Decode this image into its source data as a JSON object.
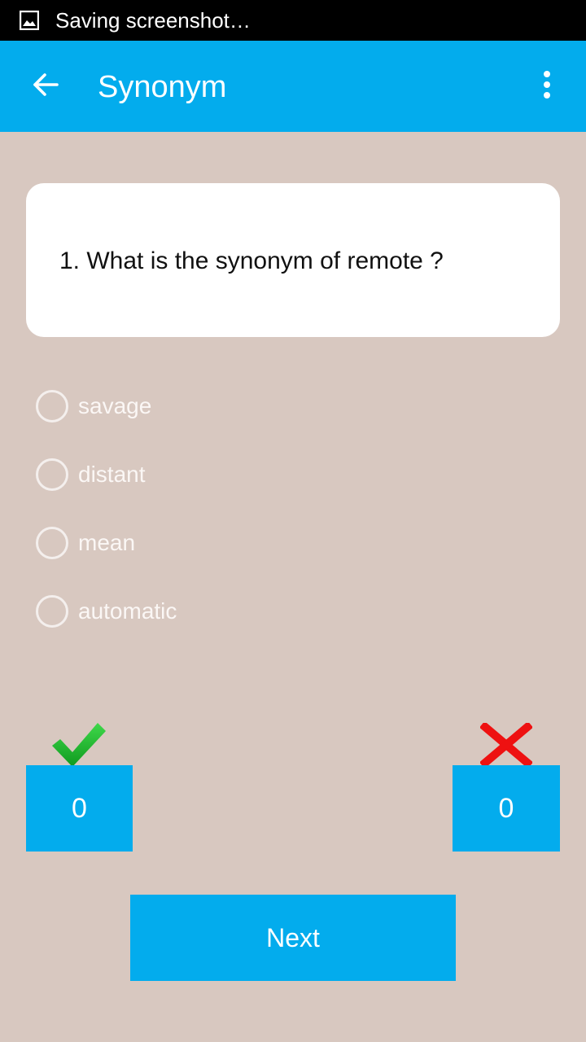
{
  "status_bar": {
    "notification_text": "Saving screenshot…"
  },
  "app_bar": {
    "title": "Synonym"
  },
  "question": {
    "text": "1. What is the synonym of remote ?"
  },
  "options": [
    {
      "label": "savage"
    },
    {
      "label": "distant"
    },
    {
      "label": "mean"
    },
    {
      "label": "automatic"
    }
  ],
  "scores": {
    "correct": "0",
    "wrong": "0"
  },
  "actions": {
    "next_label": "Next"
  },
  "colors": {
    "accent": "#03aced",
    "background": "#d8c8c0",
    "correct": "#1fbf2f",
    "wrong": "#ee1111"
  }
}
